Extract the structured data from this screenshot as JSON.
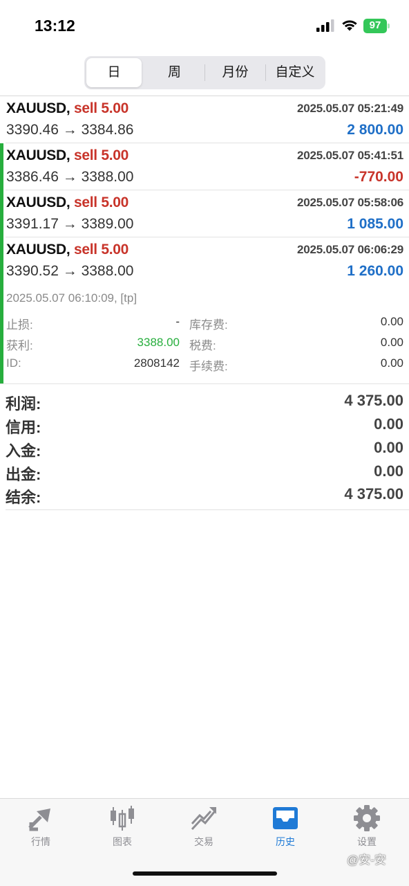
{
  "status_bar": {
    "time": "13:12",
    "battery": "97"
  },
  "period_tabs": [
    "日",
    "周",
    "月份",
    "自定义"
  ],
  "trades": [
    {
      "symbol": "XAUUSD,",
      "side": "sell 5.00",
      "time": "2025.05.07 05:21:49",
      "prices": "3390.46 → 3384.86",
      "profit": "2 800.00",
      "profit_type": "positive"
    },
    {
      "symbol": "XAUUSD,",
      "side": "sell 5.00",
      "time": "2025.05.07 05:41:51",
      "prices": "3386.46 → 3388.00",
      "profit": "-770.00",
      "profit_type": "negative"
    },
    {
      "symbol": "XAUUSD,",
      "side": "sell 5.00",
      "time": "2025.05.07 05:58:06",
      "prices": "3391.17 → 3389.00",
      "profit": "1 085.00",
      "profit_type": "positive"
    },
    {
      "symbol": "XAUUSD,",
      "side": "sell 5.00",
      "time": "2025.05.07 06:06:29",
      "prices": "3390.52 → 3388.00",
      "profit": "1 260.00",
      "profit_type": "positive"
    }
  ],
  "expanded_detail": {
    "close_time": "2025.05.07 06:10:09, [tp]",
    "stop_loss_label": "止损:",
    "stop_loss_value": "-",
    "take_profit_label": "获利:",
    "take_profit_value": "3388.00",
    "id_label": "ID:",
    "id_value": "2808142",
    "swap_label": "库存费:",
    "swap_value": "0.00",
    "tax_label": "税费:",
    "tax_value": "0.00",
    "commission_label": "手续费:",
    "commission_value": "0.00"
  },
  "summary": [
    {
      "label": "利润:",
      "value": "4 375.00"
    },
    {
      "label": "信用:",
      "value": "0.00"
    },
    {
      "label": "入金:",
      "value": "0.00"
    },
    {
      "label": "出金:",
      "value": "0.00"
    },
    {
      "label": "结余:",
      "value": "4 375.00"
    }
  ],
  "bottom_nav": [
    {
      "label": "行情",
      "icon": "quotes-arrows-icon"
    },
    {
      "label": "图表",
      "icon": "candlestick-chart-icon"
    },
    {
      "label": "交易",
      "icon": "trade-trend-icon"
    },
    {
      "label": "历史",
      "icon": "history-inbox-icon",
      "active": true
    },
    {
      "label": "设置",
      "icon": "gear-icon"
    }
  ],
  "watermark": "@安-安",
  "colors": {
    "sell": "#c8342a",
    "profit_positive": "#1f6fc7",
    "profit_negative": "#c8342a",
    "open_marker": "#27ae3d",
    "active_nav": "#1f7ad6"
  }
}
